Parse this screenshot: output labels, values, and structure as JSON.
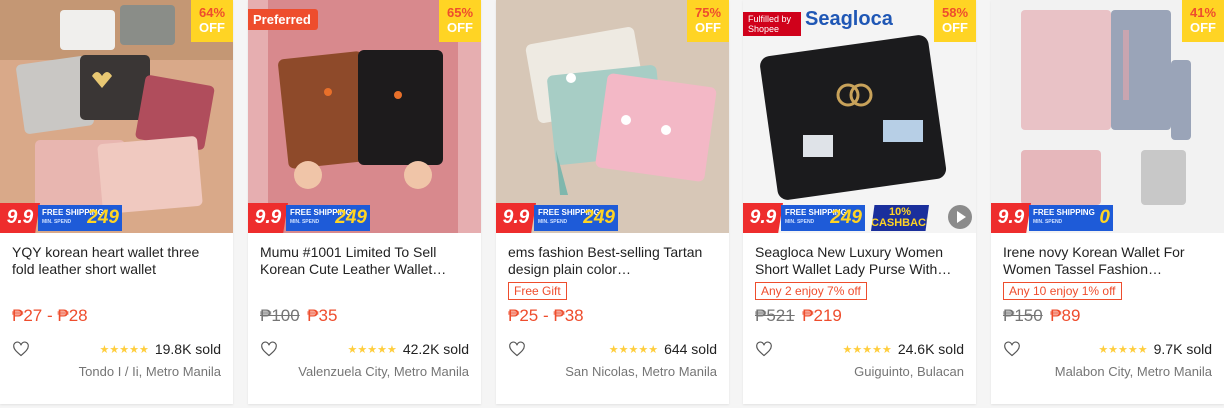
{
  "products": [
    {
      "title": "YQY korean heart wallet three fold leather short wallet",
      "discount_pct": "64%",
      "off_label": "OFF",
      "badge": "",
      "promo": {
        "nine": "9.9",
        "free_ship": "FREE SHIPPING",
        "min_spend": "MIN. SPEND",
        "amount": "249",
        "cashback": "",
        "has_video": false
      },
      "tag": "",
      "original_price": "",
      "price": "₱27 - ₱28",
      "rating_stars": "★★★★★",
      "sold": "19.8K sold",
      "location": "Tondo I / Ii, Metro Manila",
      "colors": [
        "#d9a989",
        "#c9c7c4",
        "#8a8d88"
      ]
    },
    {
      "title": "Mumu #1001 Limited To Sell Korean Cute Leather Wallet…",
      "discount_pct": "65%",
      "off_label": "OFF",
      "badge": "Preferred",
      "promo": {
        "nine": "9.9",
        "free_ship": "FREE SHIPPING",
        "min_spend": "MIN. SPEND",
        "amount": "249",
        "cashback": "",
        "has_video": false
      },
      "tag": "",
      "original_price": "₱100",
      "price": "₱35",
      "rating_stars": "★★★★★",
      "sold": "42.2K sold",
      "location": "Valenzuela City, Metro Manila",
      "colors": [
        "#d8898d",
        "#8e4a2a",
        "#1d1b1c"
      ]
    },
    {
      "title": "ems fashion Best-selling Tartan design plain color…",
      "discount_pct": "75%",
      "off_label": "OFF",
      "badge": "",
      "promo": {
        "nine": "9.9",
        "free_ship": "FREE SHIPPING",
        "min_spend": "MIN. SPEND",
        "amount": "249",
        "cashback": "",
        "has_video": false
      },
      "tag": "Free Gift",
      "original_price": "",
      "price": "₱25 - ₱38",
      "rating_stars": "★★★★★",
      "sold": "644 sold",
      "location": "San Nicolas, Metro Manila",
      "colors": [
        "#d7c7b7",
        "#a7cdc5",
        "#f3b8c6"
      ]
    },
    {
      "title": "Seagloca New Luxury Women Short Wallet Lady Purse With…",
      "discount_pct": "58%",
      "off_label": "OFF",
      "badge": "Fulfilled by Shopee",
      "brand": "Seagloca",
      "promo": {
        "nine": "9.9",
        "free_ship": "FREE SHIPPING",
        "min_spend": "MIN. SPEND",
        "amount": "249",
        "cashback": "10% CASHBACK",
        "has_video": true
      },
      "tag": "Any 2 enjoy 7% off",
      "original_price": "₱521",
      "price": "₱219",
      "rating_stars": "★★★★★",
      "sold": "24.6K sold",
      "location": "Guiguinto, Bulacan",
      "colors": [
        "#f4f4f4",
        "#1b1b1d",
        "#c8a25a"
      ]
    },
    {
      "title": "Irene novy Korean Wallet For Women Tassel Fashion…",
      "discount_pct": "41%",
      "off_label": "OFF",
      "badge": "",
      "promo": {
        "nine": "9.9",
        "free_ship": "FREE SHIPPING",
        "min_spend": "MIN. SPEND",
        "amount": "0",
        "cashback": "",
        "has_video": false
      },
      "tag": "Any 10 enjoy 1% off",
      "original_price": "₱150",
      "price": "₱89",
      "rating_stars": "★★★★★",
      "sold": "9.7K sold",
      "location": "Malabon City, Metro Manila",
      "colors": [
        "#e9c2c6",
        "#9aa4b8",
        "#f2f2f2"
      ]
    }
  ]
}
